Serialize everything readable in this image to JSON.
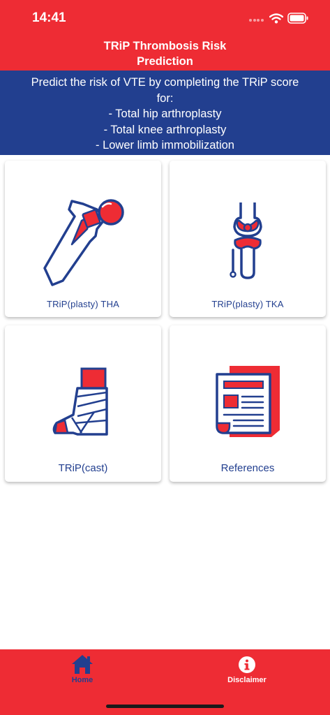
{
  "status": {
    "time": "14:41"
  },
  "header": {
    "title": "TRiP Thrombosis Risk\nPrediction"
  },
  "intro": {
    "text": "Predict the risk of VTE by completing the TRiP score\nfor:\n- Total hip arthroplasty\n- Total knee arthroplasty\n- Lower limb immobilization"
  },
  "cards": [
    {
      "label": "TRiP(plasty) THA",
      "icon": "hip-bone-icon"
    },
    {
      "label": "TRiP(plasty) TKA",
      "icon": "knee-joint-icon"
    },
    {
      "label": "TRiP(cast)",
      "icon": "cast-leg-icon"
    },
    {
      "label": "References",
      "icon": "document-icon"
    }
  ],
  "nav": [
    {
      "label": "Home",
      "icon": "home-icon",
      "active": true
    },
    {
      "label": "Disclaimer",
      "icon": "info-icon",
      "active": false
    }
  ],
  "colors": {
    "red": "#ee2c34",
    "blue": "#223f8f",
    "white": "#ffffff"
  }
}
